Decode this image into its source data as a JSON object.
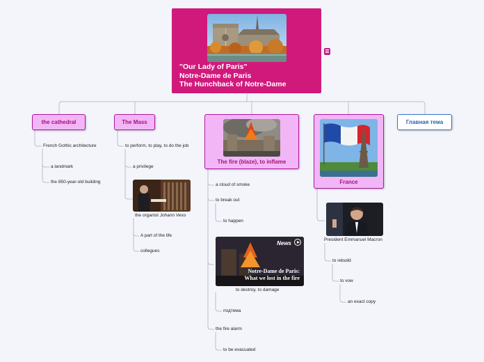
{
  "root": {
    "title_lines": [
      "\"Our Lady of Paris\"",
      "Notre-Dame de Paris",
      "The Hunchback of Notre-Dame"
    ],
    "image": "notre-dame-cathedral-photo"
  },
  "topics": {
    "cathedral": {
      "label": "the cathedral",
      "children": {
        "gothic": "French Gothic architecture",
        "landmark": "a landmark",
        "building": "the 850-year-old building"
      }
    },
    "mass": {
      "label": "The Mass",
      "children": {
        "perform": "to perform, to play, to do the job",
        "privilege": "a privilege",
        "organist": "the organist Johann Vexo",
        "part": "A part of the life",
        "colleagues": "collegues"
      }
    },
    "fire": {
      "label": "The fire (blaze), to inflame",
      "children": {
        "smoke": "a cloud of smoke",
        "break_out": "to break out",
        "happen": "to happen",
        "destroy": "to destroy, to damage",
        "podtema": "подтема",
        "alarm": "the fire alarm",
        "evacuated": "to be evacuated"
      },
      "video": {
        "brand": "News",
        "caption_line1": "Notre-Dame de Paris:",
        "caption_line2": "What we lost in the fire"
      }
    },
    "france": {
      "label": "France",
      "children": {
        "macron": "President Emmanuel Macron",
        "rebuild": "to rebuild",
        "vow": "to vow",
        "copy": "an exact copy"
      }
    },
    "main": {
      "label": "Главная тема"
    }
  },
  "colors": {
    "root": "#d1197c",
    "topic_fill": "#f2b6f7",
    "topic_border": "#b0169e",
    "main_topic_border": "#3574c8",
    "background": "#f3f5fb"
  }
}
